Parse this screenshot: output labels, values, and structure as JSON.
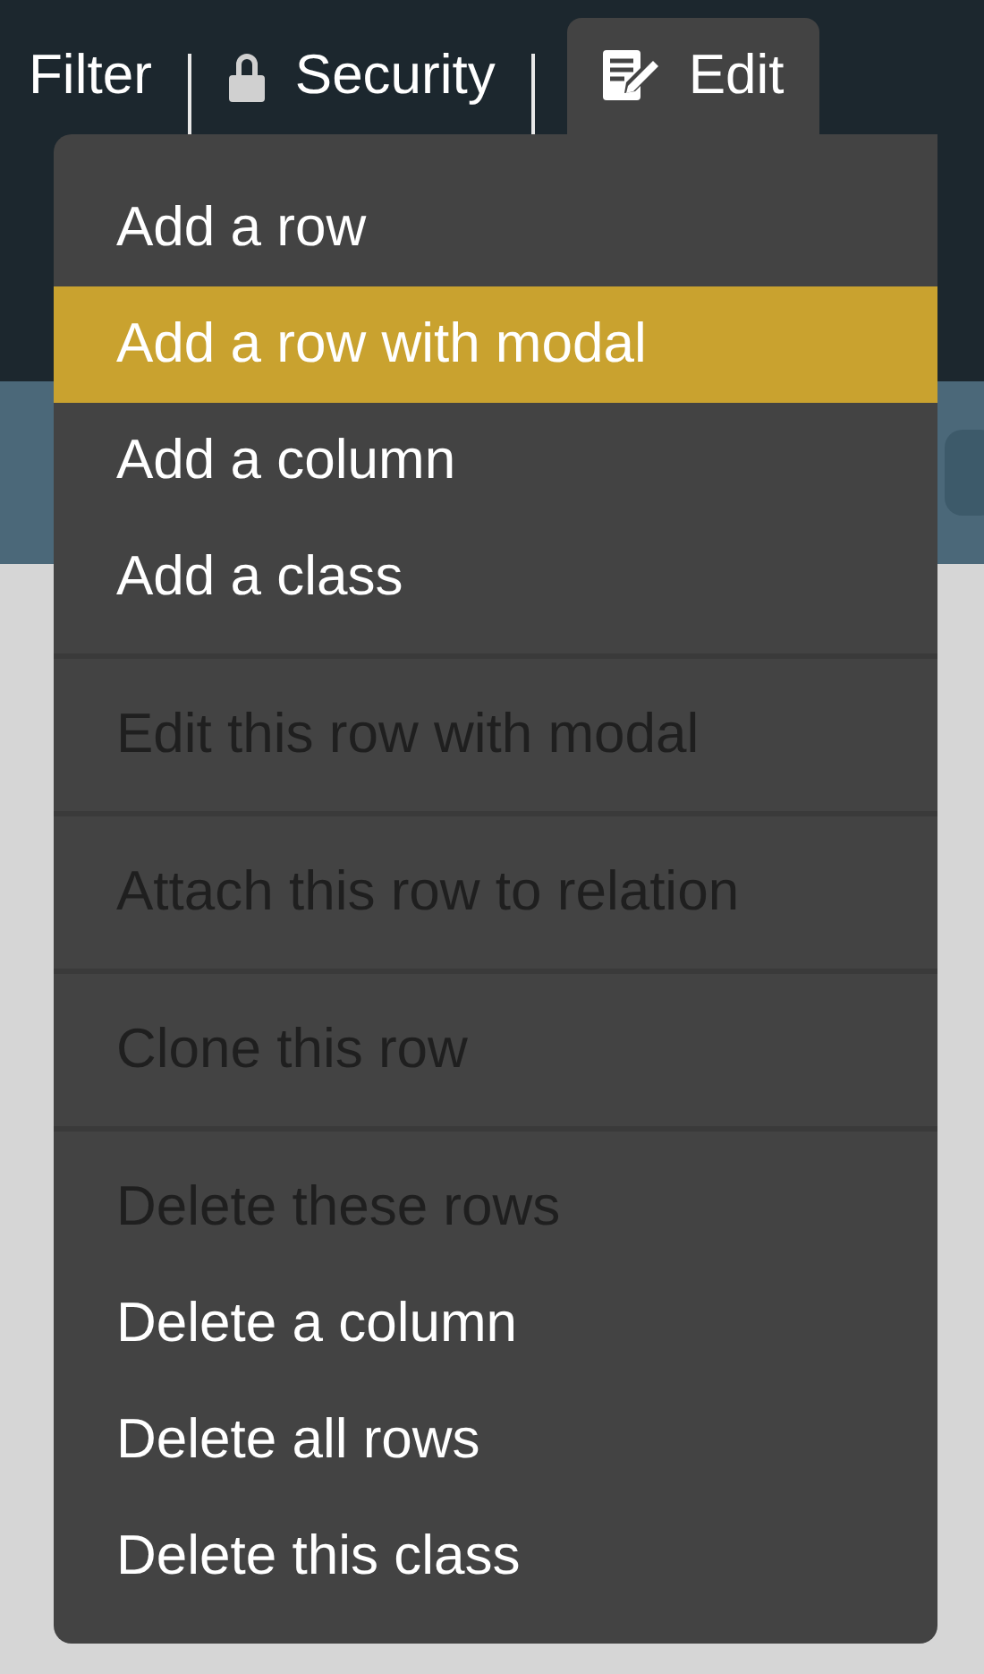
{
  "nav": [
    {
      "label": "Filter",
      "selected": false
    },
    {
      "label": "Security",
      "selected": false
    },
    {
      "label": "Edit",
      "selected": true
    }
  ],
  "menu": {
    "groups": [
      {
        "items": [
          {
            "label": "Add a row",
            "selected": false,
            "disabled": false
          },
          {
            "label": "Add a row with modal",
            "selected": true,
            "disabled": false
          },
          {
            "label": "Add a column",
            "selected": false,
            "disabled": false
          },
          {
            "label": "Add a class",
            "selected": false,
            "disabled": false
          }
        ]
      },
      {
        "items": [
          {
            "label": "Edit this row with modal",
            "selected": false,
            "disabled": true
          }
        ]
      },
      {
        "items": [
          {
            "label": "Attach this row to relation",
            "selected": false,
            "disabled": true
          }
        ]
      },
      {
        "items": [
          {
            "label": "Clone this row",
            "selected": false,
            "disabled": true
          }
        ]
      },
      {
        "items": [
          {
            "label": "Delete these rows",
            "selected": false,
            "disabled": true
          },
          {
            "label": "Delete a column",
            "selected": false,
            "disabled": false
          },
          {
            "label": "Delete all rows",
            "selected": false,
            "disabled": false
          },
          {
            "label": "Delete this class",
            "selected": false,
            "disabled": false
          }
        ]
      }
    ]
  }
}
